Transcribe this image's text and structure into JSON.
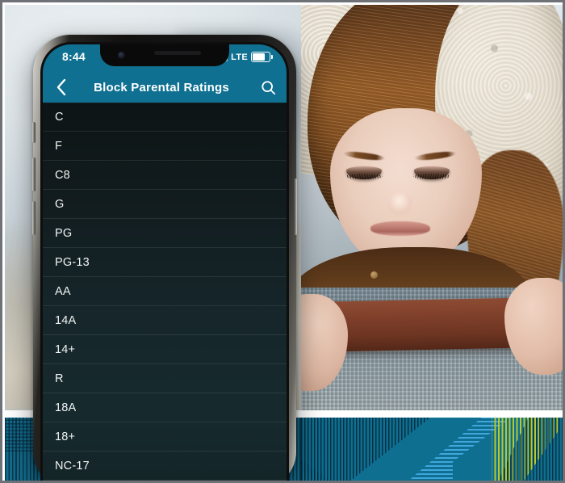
{
  "page": {
    "title": "Block Parental Ratings mobile app screen"
  },
  "phone": {
    "status_bar": {
      "time": "8:44",
      "network_label": "LTE",
      "signal_icon": "signal-bars-icon",
      "battery_icon": "battery-icon"
    },
    "nav_bar": {
      "back_icon": "chevron-left-icon",
      "title": "Block Parental Ratings",
      "search_icon": "search-icon"
    },
    "ratings_list": [
      {
        "label": "C"
      },
      {
        "label": "F"
      },
      {
        "label": "C8"
      },
      {
        "label": "G"
      },
      {
        "label": "PG"
      },
      {
        "label": "PG-13"
      },
      {
        "label": "AA"
      },
      {
        "label": "14A"
      },
      {
        "label": "14+"
      },
      {
        "label": "R"
      },
      {
        "label": "18A"
      },
      {
        "label": "18+"
      },
      {
        "label": "NC-17"
      }
    ],
    "hardware": {
      "notch_camera": "front-camera-icon",
      "notch_speaker": "earpiece-speaker",
      "mute_switch": "mute-switch-button",
      "volume_up": "volume-up-button",
      "volume_down": "volume-down-button",
      "power": "power-button"
    }
  },
  "colors": {
    "accent_teal": "#0f7091",
    "list_background_top": "#0d1415",
    "list_background_bottom": "#162a2e",
    "text_primary": "#f2f4f4",
    "pattern_teal": "#0f6f91",
    "pattern_light_blue": "#3fa7dd",
    "pattern_yellow_green": "#b9c92c",
    "frame_border": "#6e7276"
  },
  "decor": {
    "left_photo_alt": "blurred light gray living room background",
    "right_photo_alt": "young girl under a fleece blanket looking at a tablet",
    "bottom_pattern_alt": "teal geometric striped graphic band"
  }
}
